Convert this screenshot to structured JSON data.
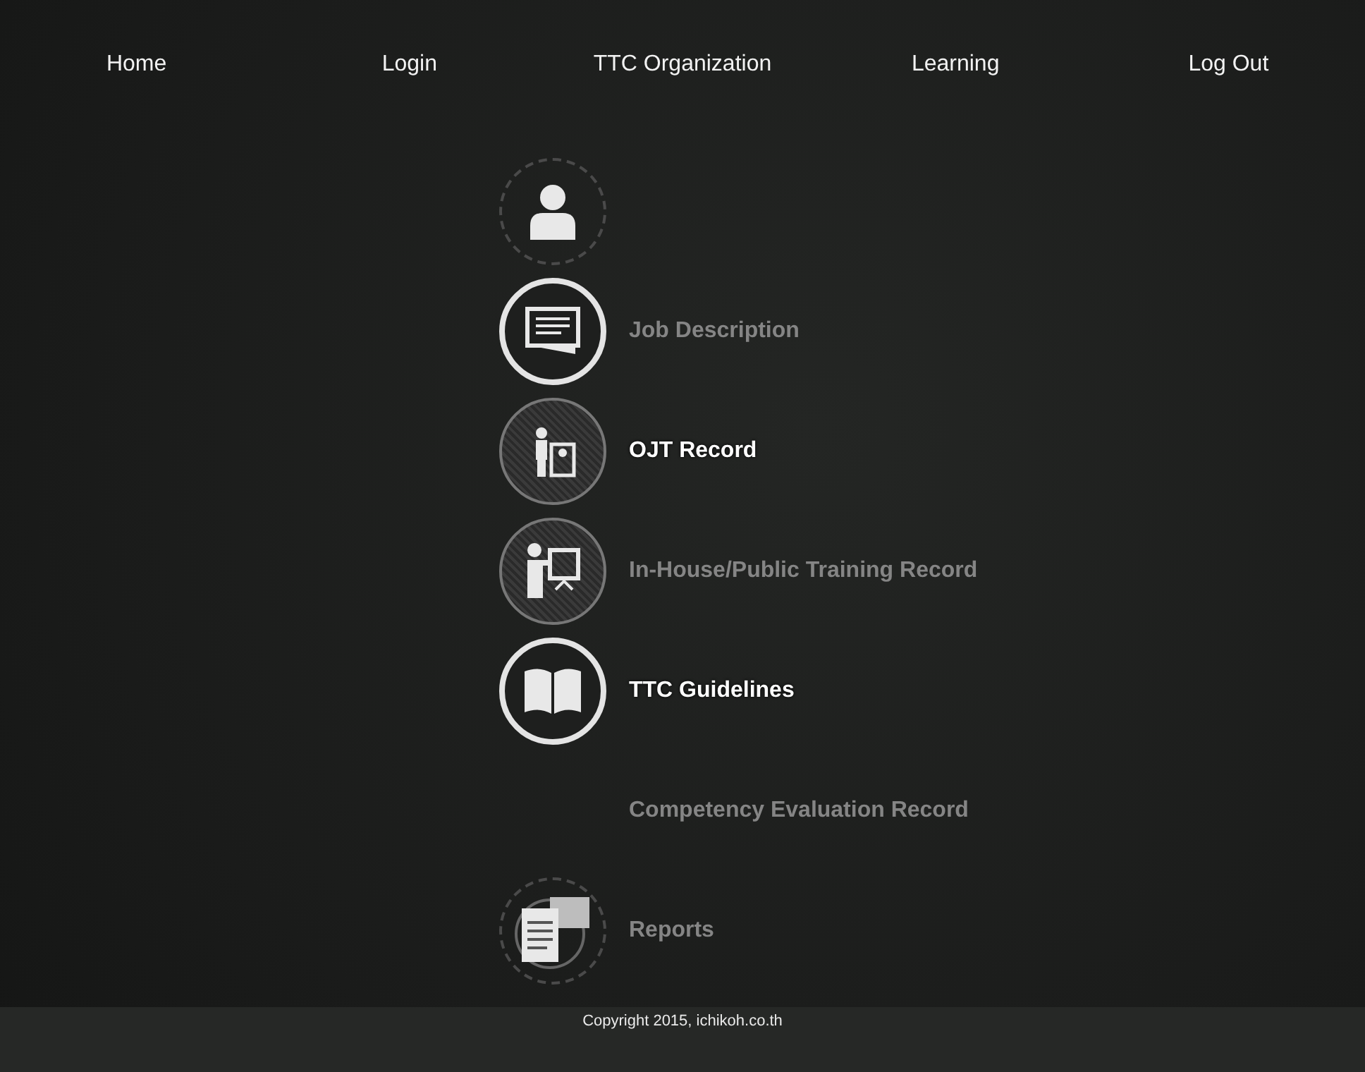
{
  "nav": [
    {
      "label": "Home"
    },
    {
      "label": "Login"
    },
    {
      "label": "TTC Organization"
    },
    {
      "label": "Learning"
    },
    {
      "label": "Log Out"
    }
  ],
  "menu": [
    {
      "kind": "faint"
    },
    {
      "kind": "solid",
      "highlighted": false,
      "label": "Job Description"
    },
    {
      "kind": "textured",
      "highlighted": true,
      "label": "OJT Record"
    },
    {
      "kind": "textured",
      "highlighted": false,
      "label": "In-House/Public Training Record"
    },
    {
      "kind": "solid",
      "highlighted": true,
      "label": "TTC Guidelines"
    },
    {
      "kind": "plain",
      "highlighted": false,
      "label": "Competency Evaluation Record"
    },
    {
      "kind": "faint",
      "highlighted": false,
      "label": "Reports"
    }
  ],
  "footer": "Copyright 2015, ichikoh.co.th"
}
